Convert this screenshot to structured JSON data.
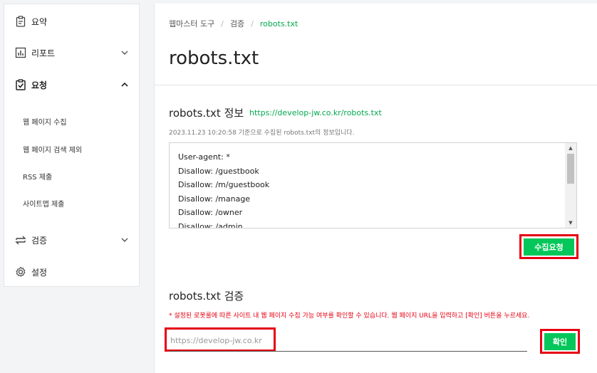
{
  "sidebar": {
    "items": [
      {
        "label": "요약",
        "icon": "clipboard-icon"
      },
      {
        "label": "리포트",
        "icon": "chart-icon"
      },
      {
        "label": "요청",
        "icon": "check-clipboard-icon"
      },
      {
        "label": "검증",
        "icon": "swap-icon"
      },
      {
        "label": "설정",
        "icon": "gear-icon"
      }
    ],
    "sub_items": [
      "웹 페이지 수집",
      "웹 페이지 검색 제외",
      "RSS 제출",
      "사이트맵 제출"
    ]
  },
  "breadcrumb": {
    "items": [
      "웹마스터 도구",
      "검증",
      "robots.txt"
    ]
  },
  "page_title": "robots.txt",
  "info": {
    "title": "robots.txt 정보",
    "link": "https://develop-jw.co.kr/robots.txt",
    "description": "2023.11.23 10:20:58 기준으로 수집된 robots.txt의 정보입니다.",
    "lines": [
      "User-agent: *",
      "Disallow: /guestbook",
      "Disallow: /m/guestbook",
      "Disallow: /manage",
      "Disallow: /owner",
      "Disallow: /admin"
    ],
    "collect_button": "수집요청"
  },
  "verify": {
    "title": "robots.txt 검증",
    "note": "* 설정된 로봇룰에 따른 사이트 내 웹 페이지 수집 가능 여부를 확인할 수 있습니다. 웹 페이지 URL을 입력하고 [확인] 버튼을 누르세요.",
    "url_placeholder": "https://develop-jw.co.kr",
    "confirm_button": "확인"
  },
  "colors": {
    "accent": "#03c75a",
    "link": "#03a94d",
    "highlight": "#e60012"
  }
}
